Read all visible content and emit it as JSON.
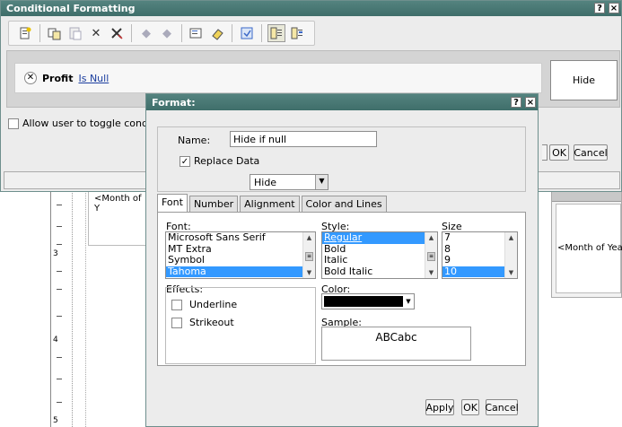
{
  "cf_window": {
    "title": "Conditional Formatting",
    "help_label": "?",
    "close_label": "×",
    "toolbar_icons": [
      "new-condition-icon",
      "copy-icon",
      "paste-icon",
      "delete-icon",
      "clear-icon",
      "move-up-icon",
      "move-down-icon",
      "format-icon",
      "eraser-icon",
      "apply-icon",
      "layout-icon",
      "layout-alt-icon"
    ],
    "condition": {
      "field": "Profit",
      "operator": "Is Null",
      "action": "Hide"
    },
    "allow_toggle_label": "Allow user to toggle condition",
    "ok_label": "OK",
    "cancel_label": "Cancel"
  },
  "background": {
    "cell_text": "<Month of Y",
    "cell_text_right": "<Month of Yea",
    "ruler_numbers": [
      "3",
      "4",
      "5"
    ]
  },
  "format_dialog": {
    "title": "Format:",
    "help_label": "?",
    "close_label": "×",
    "name_label": "Name:",
    "name_value": "Hide if null",
    "replace_label": "Replace Data",
    "replace_checked": true,
    "replace_value": "Hide",
    "tabs": [
      "Font",
      "Number",
      "Alignment",
      "Color and Lines"
    ],
    "active_tab": "Font",
    "font_label": "Font:",
    "fonts": [
      "Microsoft Sans Serif",
      "MT Extra",
      "Symbol",
      "Tahoma"
    ],
    "selected_font": "Tahoma",
    "style_label": "Style:",
    "styles": [
      "Regular",
      "Bold",
      "Italic",
      "Bold Italic"
    ],
    "selected_style": "Regular",
    "size_label": "Size",
    "sizes": [
      "7",
      "8",
      "9",
      "10"
    ],
    "selected_size": "10",
    "effects_label": "Effects:",
    "underline_label": "Underline",
    "strikeout_label": "Strikeout",
    "color_label": "Color:",
    "color_value": "#000000",
    "sample_label": "Sample:",
    "sample_text": "ABCabc",
    "apply_label": "Apply",
    "ok_label": "OK",
    "cancel_label": "Cancel"
  }
}
